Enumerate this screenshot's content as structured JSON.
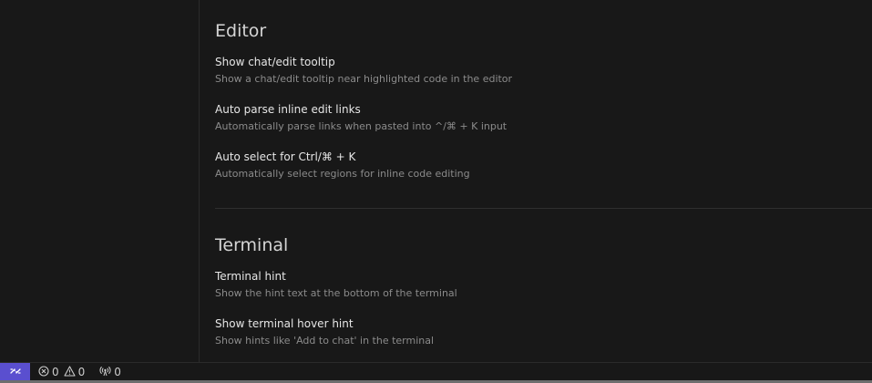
{
  "sections": {
    "editor": {
      "title": "Editor",
      "settings": [
        {
          "label": "Show chat/edit tooltip",
          "description": "Show a chat/edit tooltip near highlighted code in the editor"
        },
        {
          "label": "Auto parse inline edit links",
          "description": "Automatically parse links when pasted into ^/⌘ + K input"
        },
        {
          "label": "Auto select for Ctrl/⌘ + K",
          "description": "Automatically select regions for inline code editing"
        }
      ]
    },
    "terminal": {
      "title": "Terminal",
      "settings": [
        {
          "label": "Terminal hint",
          "description": "Show the hint text at the bottom of the terminal"
        },
        {
          "label": "Show terminal hover hint",
          "description": "Show hints like 'Add to chat' in the terminal"
        }
      ]
    }
  },
  "statusbar": {
    "errors": "0",
    "warnings": "0",
    "ports": "0",
    "remote_icon": "remote-icon",
    "accent_color": "#5a4fcf"
  }
}
